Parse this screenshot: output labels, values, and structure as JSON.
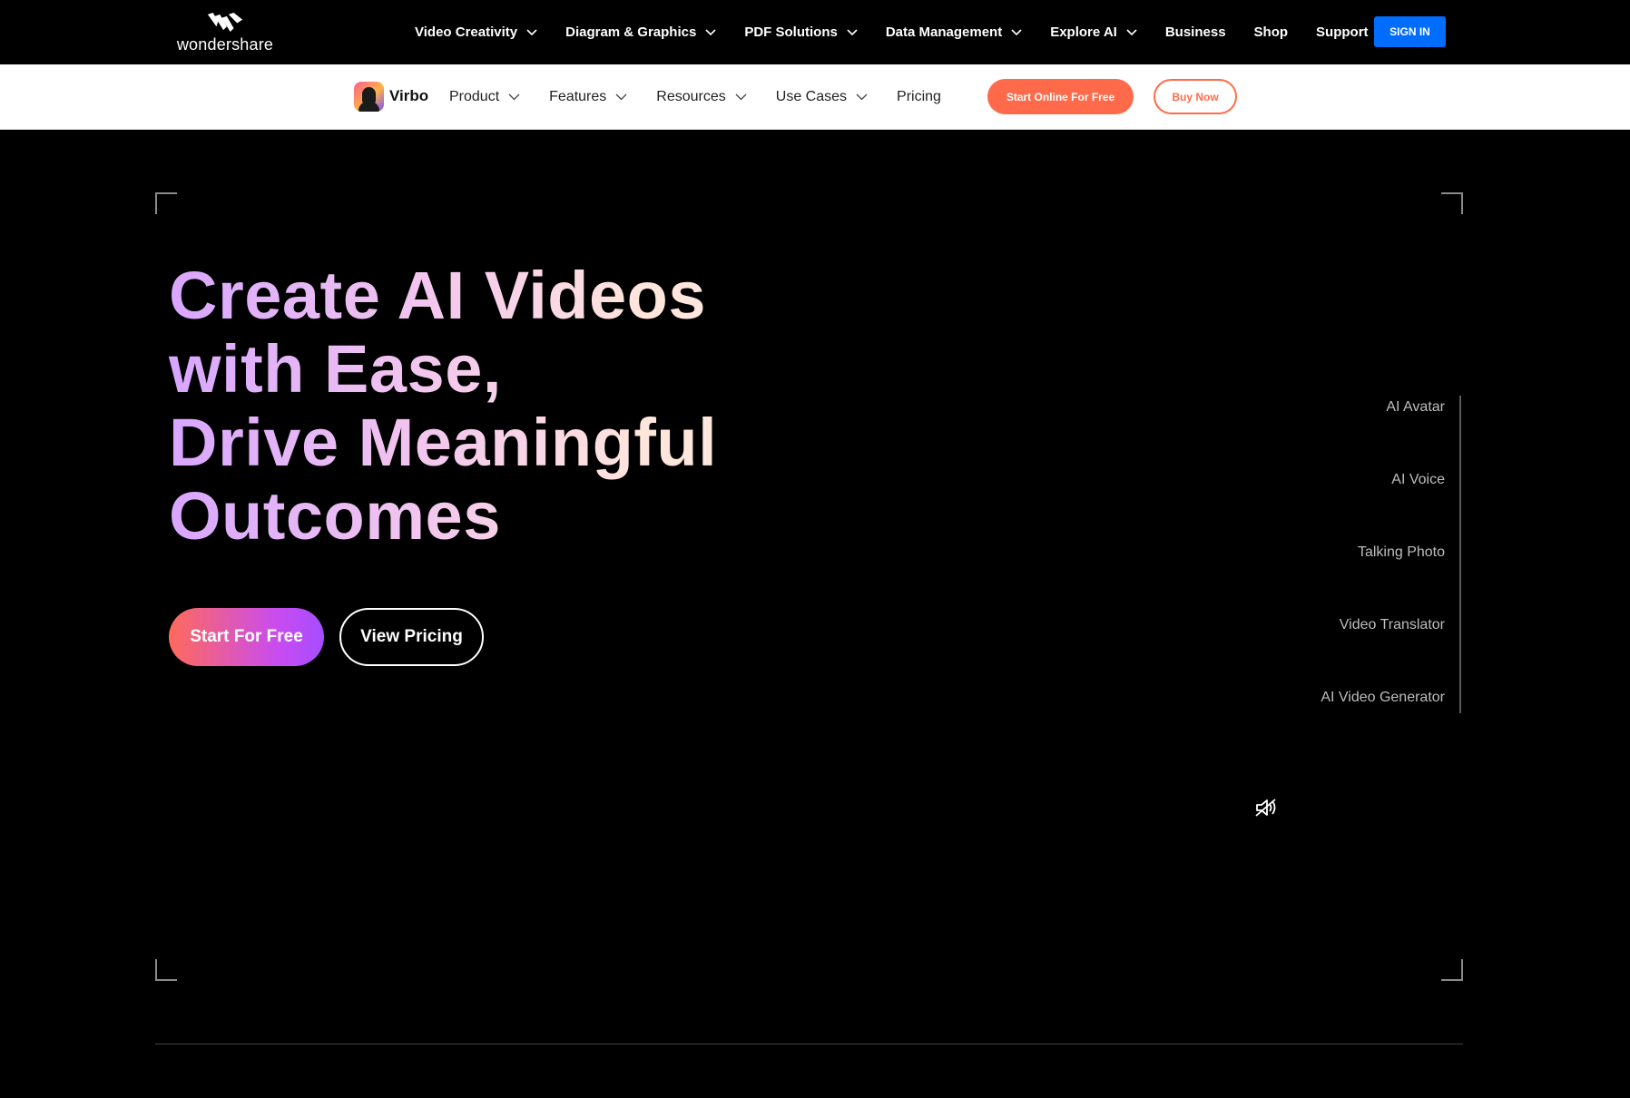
{
  "global_nav": {
    "brand": "wondershare",
    "items": [
      {
        "label": "Video Creativity",
        "has_dropdown": true
      },
      {
        "label": "Diagram & Graphics",
        "has_dropdown": true
      },
      {
        "label": "PDF Solutions",
        "has_dropdown": true
      },
      {
        "label": "Data Management",
        "has_dropdown": true
      },
      {
        "label": "Explore AI",
        "has_dropdown": true
      },
      {
        "label": "Business",
        "has_dropdown": false
      },
      {
        "label": "Shop",
        "has_dropdown": false
      },
      {
        "label": "Support",
        "has_dropdown": false
      }
    ],
    "signin_label": "SIGN IN",
    "signin_color": "#006dff"
  },
  "product_nav": {
    "product_name": "Virbo",
    "items": [
      {
        "label": "Product",
        "has_dropdown": true
      },
      {
        "label": "Features",
        "has_dropdown": true
      },
      {
        "label": "Resources",
        "has_dropdown": true
      },
      {
        "label": "Use Cases",
        "has_dropdown": true
      },
      {
        "label": "Pricing",
        "has_dropdown": false
      }
    ],
    "start_online_label": "Start Online For Free",
    "buy_now_label": "Buy Now",
    "accent_color": "#ff6b4a"
  },
  "hero": {
    "headline_lines": [
      "Create AI Videos",
      "with Ease,",
      "Drive Meaningful",
      "Outcomes"
    ],
    "start_button_label": "Start For Free",
    "pricing_button_label": "View Pricing",
    "features": [
      "AI Avatar",
      "AI Voice",
      "Talking Photo",
      "Video Translator",
      "AI Video Generator"
    ],
    "mute_icon": "speaker-muted-icon"
  }
}
